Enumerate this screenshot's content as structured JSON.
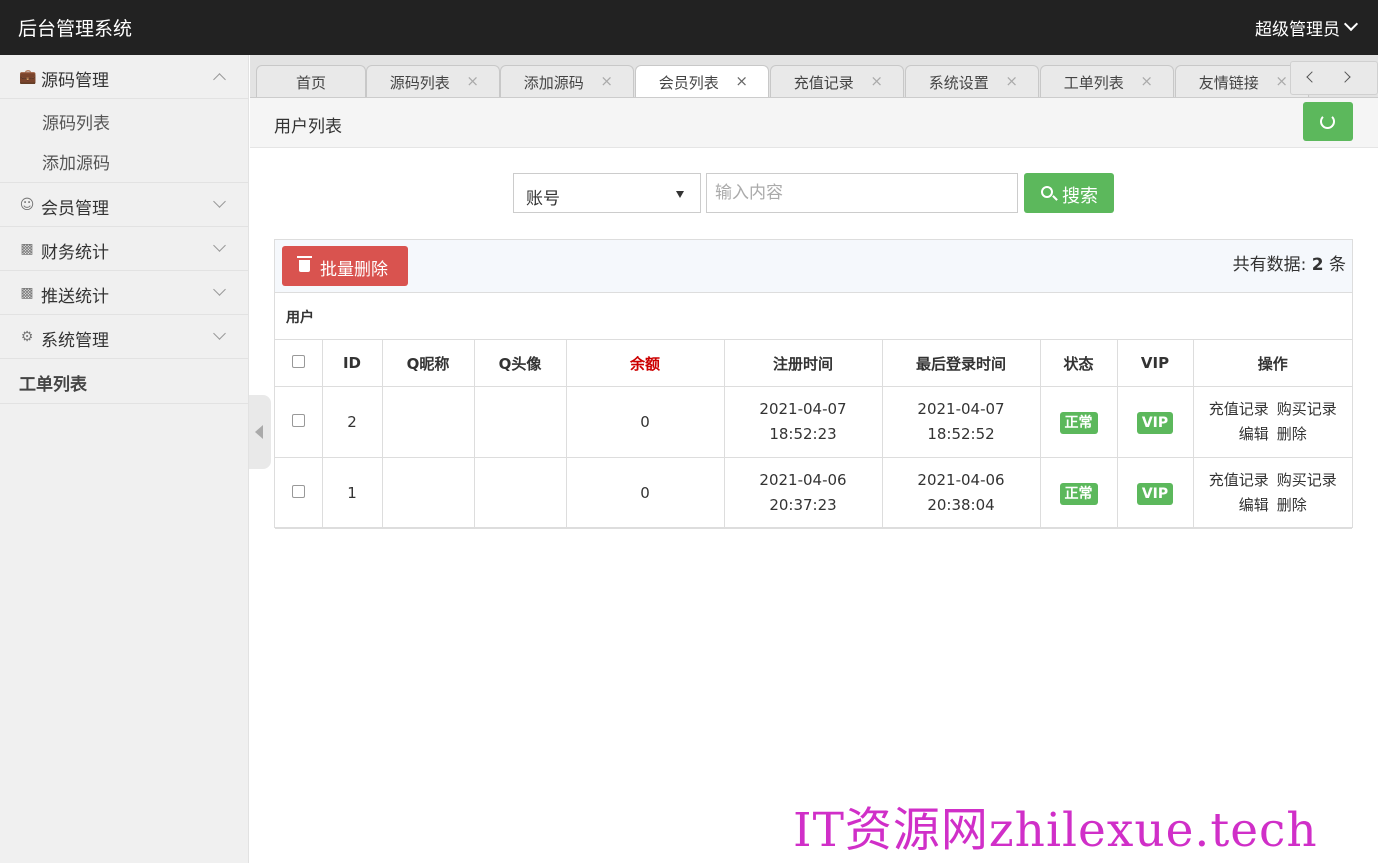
{
  "topbar": {
    "brand": "后台管理系统",
    "user": "超级管理员"
  },
  "sidebar": {
    "groups": [
      {
        "label": "源码管理",
        "icon": "bag-icon",
        "expanded": true,
        "children": [
          "源码列表",
          "添加源码"
        ]
      },
      {
        "label": "会员管理",
        "icon": "user-icon",
        "expanded": false
      },
      {
        "label": "财务统计",
        "icon": "truck-icon",
        "expanded": false
      },
      {
        "label": "推送统计",
        "icon": "truck-icon",
        "expanded": false
      },
      {
        "label": "系统管理",
        "icon": "gear-icon",
        "expanded": false
      }
    ],
    "plain_item": "工单列表"
  },
  "tabs": [
    {
      "label": "首页"
    },
    {
      "label": "源码列表"
    },
    {
      "label": "添加源码"
    },
    {
      "label": "会员列表",
      "active": true
    },
    {
      "label": "充值记录"
    },
    {
      "label": "系统设置"
    },
    {
      "label": "工单列表"
    },
    {
      "label": "友情链接"
    }
  ],
  "tab_close_glyph": "×",
  "page": {
    "title": "用户列表"
  },
  "search": {
    "field": "账号",
    "placeholder": "输入内容",
    "button": "搜索"
  },
  "toolbar": {
    "batch_delete": "批量删除",
    "total_prefix": "共有数据:",
    "total_count": "2",
    "total_suffix": "条"
  },
  "table": {
    "caption": "用户",
    "columns": [
      "ID",
      "Q昵称",
      "Q头像",
      "余额",
      "注册时间",
      "最后登录时间",
      "状态",
      "VIP",
      "操作"
    ],
    "rows": [
      {
        "id": "2",
        "nick": "",
        "avatar": "",
        "balance": "0",
        "reg_time": "2021-04-07 18:52:23",
        "last_login": "2021-04-07 18:52:52",
        "status": "正常",
        "vip": "VIP",
        "ops": [
          "充值记录",
          "购买记录",
          "编辑",
          "删除"
        ]
      },
      {
        "id": "1",
        "nick": "",
        "avatar": "",
        "balance": "0",
        "reg_time": "2021-04-06 20:37:23",
        "last_login": "2021-04-06 20:38:04",
        "status": "正常",
        "vip": "VIP",
        "ops": [
          "充值记录",
          "购买记录",
          "编辑",
          "删除"
        ]
      }
    ]
  },
  "watermark": "IT资源网zhilexue.tech",
  "colors": {
    "green": "#5cb85c",
    "red": "#d9534f",
    "topbar": "#222222",
    "watermark": "#d02fc8"
  }
}
